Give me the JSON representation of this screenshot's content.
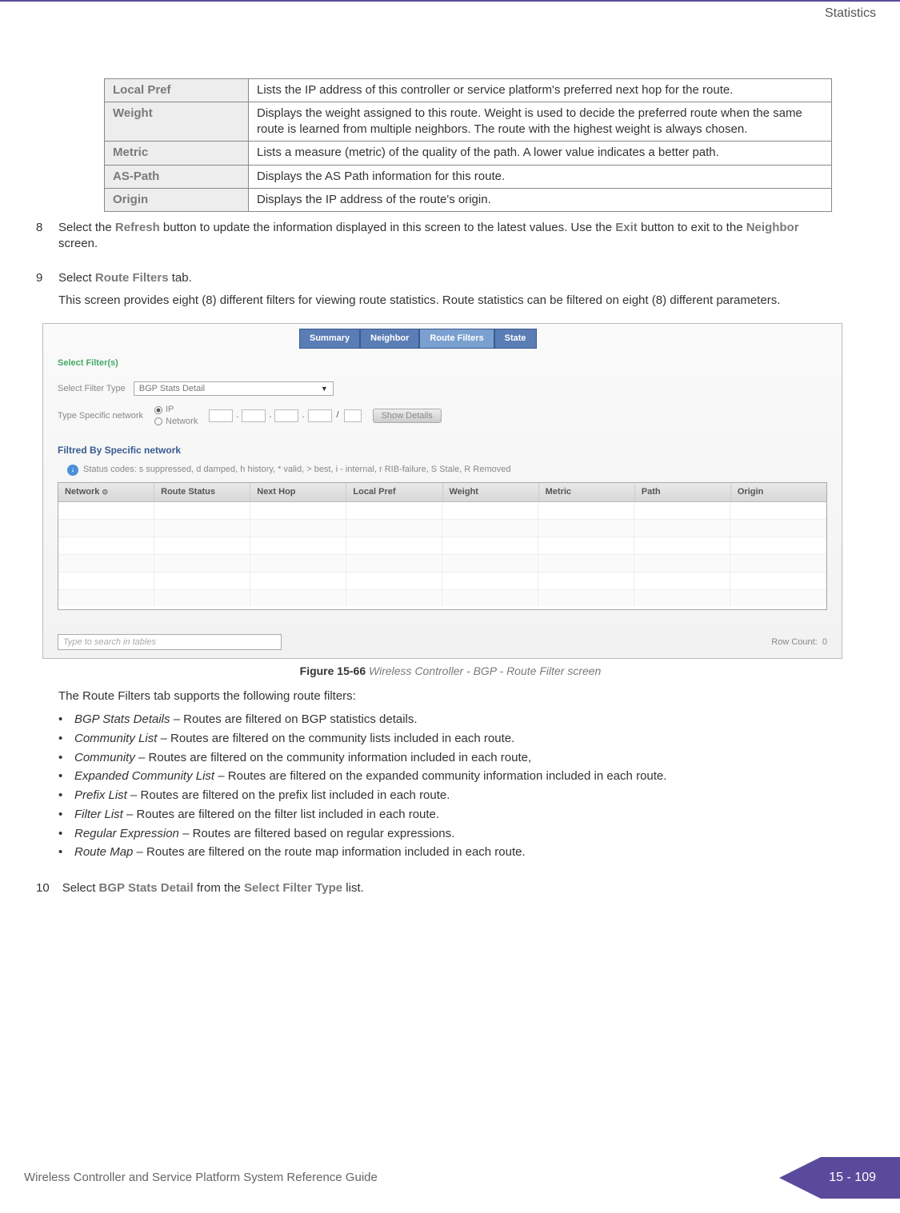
{
  "header": {
    "section": "Statistics"
  },
  "defs": [
    {
      "term": "Local Pref",
      "desc": "Lists the IP address of this controller or service platform's preferred next hop for the route."
    },
    {
      "term": "Weight",
      "desc": "Displays the weight assigned to this route. Weight is used to decide the preferred route when the same route is learned from multiple neighbors. The route with the highest weight is always chosen."
    },
    {
      "term": "Metric",
      "desc": "Lists a measure (metric) of the quality of the path. A lower value indicates a better path."
    },
    {
      "term": "AS-Path",
      "desc": "Displays the AS Path information for this route."
    },
    {
      "term": "Origin",
      "desc": "Displays the IP address of the route's origin."
    }
  ],
  "steps": {
    "s8_num": "8",
    "s8_pre": "Select the ",
    "s8_refresh": "Refresh",
    "s8_mid": " button to update the information displayed in this screen to the latest values. Use the ",
    "s8_exit": "Exit",
    "s8_mid2": " button to exit to the ",
    "s8_neighbor": "Neighbor",
    "s8_post": " screen.",
    "s9_num": "9",
    "s9_pre": "Select ",
    "s9_rf": "Route Filters",
    "s9_post": " tab.",
    "s9_body": "This screen provides eight (8) different filters for viewing route statistics. Route statistics can be filtered on eight (8) different parameters.",
    "s9_after_figure": "The Route Filters tab supports the following route filters:",
    "s10_num": "10",
    "s10_pre": "Select ",
    "s10_kw": "BGP Stats Detail",
    "s10_mid": " from the ",
    "s10_kw2": "Select Filter Type",
    "s10_post": " list."
  },
  "figure": {
    "tabs": [
      "Summary",
      "Neighbor",
      "Route Filters",
      "State"
    ],
    "select_filters_label": "Select Filter(s)",
    "filter_type_label": "Select Filter Type",
    "filter_type_value": "BGP Stats Detail",
    "type_specific_label": "Type Specific network",
    "radio_ip": "IP",
    "radio_net": "Network",
    "show_details": "Show Details",
    "filtered_label": "Filtred By Specific network",
    "status_codes": "Status codes: s suppressed, d damped, h history, * valid, > best, i - internal, r RIB-failure, S Stale, R Removed",
    "columns": [
      "Network",
      "Route Status",
      "Next Hop",
      "Local Pref",
      "Weight",
      "Metric",
      "Path",
      "Origin"
    ],
    "search_placeholder": "Type to search in tables",
    "row_count_label": "Row Count:",
    "row_count_value": "0",
    "caption_num": "Figure 15-66",
    "caption_title": "Wireless Controller - BGP - Route Filter screen"
  },
  "bullets": [
    {
      "term": "BGP Stats Details",
      "desc": " – Routes are filtered on BGP statistics details."
    },
    {
      "term": "Community List",
      "desc": " – Routes are filtered on the community lists included in each route."
    },
    {
      "term": "Community",
      "desc": " – Routes are filtered on the community information included in each route,"
    },
    {
      "term": "Expanded Community List",
      "desc": " – Routes are filtered on the expanded community information included in each route."
    },
    {
      "term": "Prefix List",
      "desc": " – Routes are filtered on the prefix list included in each route."
    },
    {
      "term": "Filter List",
      "desc": " – Routes are filtered on the filter list included in each route."
    },
    {
      "term": "Regular Expression",
      "desc": " – Routes are filtered based on regular expressions."
    },
    {
      "term": "Route Map",
      "desc": " – Routes are filtered on the route map information included in each route."
    }
  ],
  "footer": {
    "text": "Wireless Controller and Service Platform System Reference Guide",
    "page": "15 - 109"
  }
}
